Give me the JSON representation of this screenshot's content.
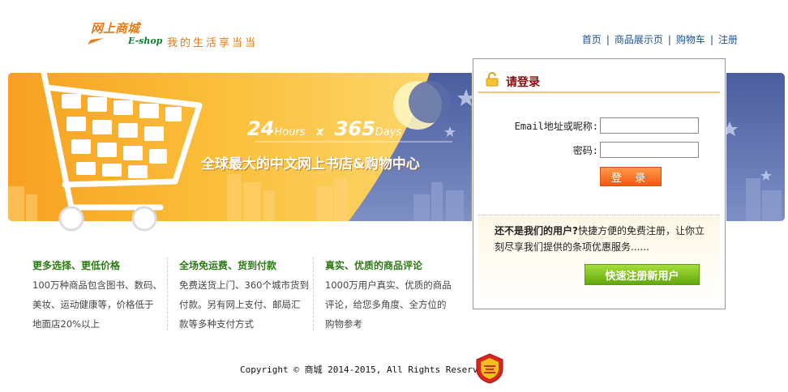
{
  "brand": {
    "name_cn": "网上商城",
    "name_en": "E-shop",
    "slogan": "我的生活享当当"
  },
  "nav": {
    "items": [
      {
        "label": "首页"
      },
      {
        "label": "商品展示页"
      },
      {
        "label": "购物车"
      },
      {
        "label": "注册"
      }
    ]
  },
  "banner": {
    "hours_num": "24",
    "hours_unit": "Hours",
    "times": "x",
    "days_num": "365",
    "days_unit": "Days",
    "subtitle": "全球最大的中文网上书店&购物中心"
  },
  "login": {
    "title": "请登录",
    "email_label": "Email地址或昵称:",
    "email_value": "",
    "password_label": "密码:",
    "password_value": "",
    "submit_label": "登 录",
    "promo_bold": "还不是我们的用户?",
    "promo_text": "快捷方便的免费注册，让你立刻尽享我们提供的条项优惠服务......",
    "register_label": "快速注册新用户"
  },
  "features": [
    {
      "title": "更多选择、更低价格",
      "text": "100万种商品包含图书、数码、美妆、运动健康等，价格低于地面店20%以上"
    },
    {
      "title": "全场免运费、货到付款",
      "text": "免费送货上门、360个城市货到付款。另有网上支付、邮局汇款等多种支付方式"
    },
    {
      "title": "真实、优质的商品评论",
      "text": "1000万用户真实、优质的商品评论，给您多角度、全方位的购物参考"
    }
  ],
  "footer": {
    "copyright": "Copyright © 商城 2014-2015, All Rights Reserved"
  },
  "colors": {
    "accent_orange": "#f08a1c",
    "night_blue": "#5b6fae",
    "login_title": "#8b0a0a",
    "feature_green": "#2c7a13",
    "nav_blue": "#1a4f8c"
  }
}
